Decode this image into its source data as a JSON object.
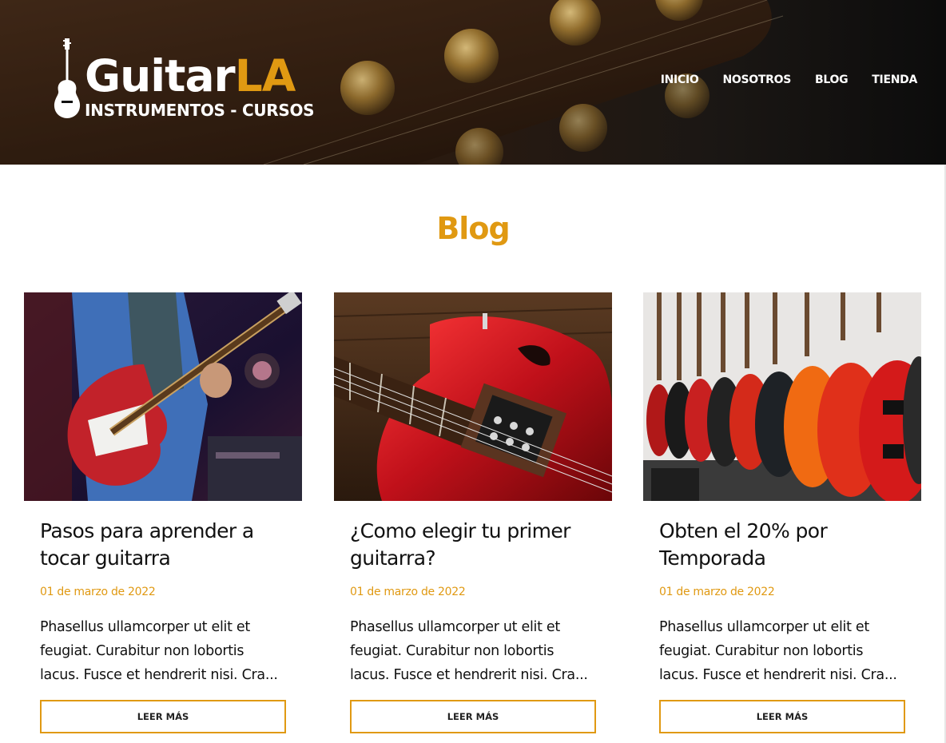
{
  "brand": {
    "name_main": "Guitar",
    "name_accent": "LA",
    "tagline": "INSTRUMENTOS - CURSOS",
    "accent_color": "#e09912"
  },
  "nav": {
    "items": [
      {
        "label": "INICIO"
      },
      {
        "label": "NOSOTROS"
      },
      {
        "label": "BLOG"
      },
      {
        "label": "TIENDA"
      }
    ]
  },
  "page": {
    "title": "Blog"
  },
  "posts": [
    {
      "title": "Pasos para aprender a tocar guitarra",
      "date": "01 de marzo de 2022",
      "excerpt": "Phasellus ullamcorper ut elit et feugiat. Curabitur non lobortis lacus. Fusce et hendrerit nisi. Cra...",
      "button": "LEER MÁS",
      "image": "guitarist-playing-red-electric-guitar"
    },
    {
      "title": "¿Como elegir tu primer guitarra?",
      "date": "01 de marzo de 2022",
      "excerpt": "Phasellus ullamcorper ut elit et feugiat. Curabitur non lobortis lacus. Fusce et hendrerit nisi. Cra...",
      "button": "LEER MÁS",
      "image": "red-guitar-closeup-on-wood"
    },
    {
      "title": "Obten el 20% por Temporada",
      "date": "01 de marzo de 2022",
      "excerpt": "Phasellus ullamcorper ut elit et feugiat. Curabitur non lobortis lacus. Fusce et hendrerit nisi. Cra...",
      "button": "LEER MÁS",
      "image": "guitars-hanging-in-store"
    }
  ]
}
